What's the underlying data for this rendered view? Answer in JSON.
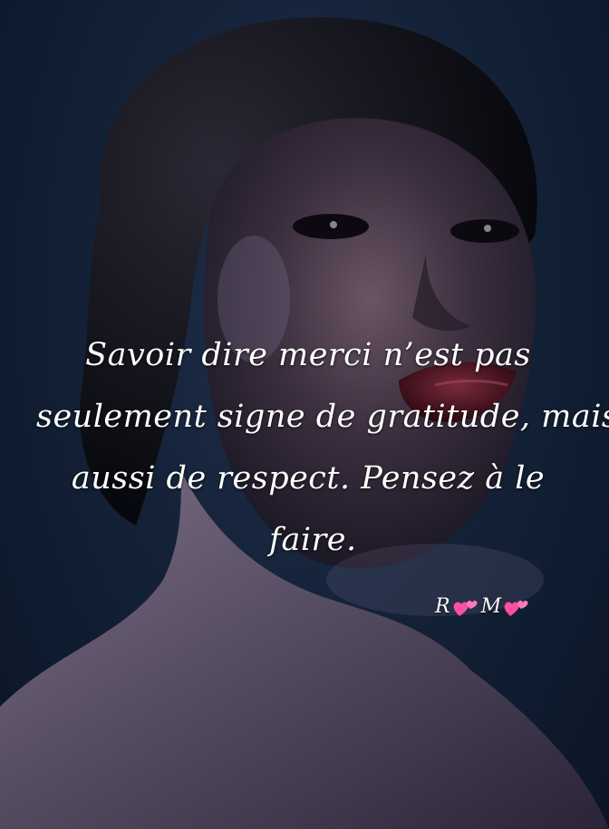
{
  "quote": {
    "lines": [
      "Savoir dire merci n’est pas",
      "seulement signe de gratitude, mais",
      "aussi de respect. Pensez à le",
      "faire."
    ]
  },
  "signature": {
    "initial_1": "R",
    "initial_2": "M",
    "icon": "two-hearts-icon",
    "heart_color": "#ff4fa0"
  },
  "colors": {
    "background": "#0e1a2e",
    "text": "#ffffff",
    "lips": "#4a0f1e"
  }
}
